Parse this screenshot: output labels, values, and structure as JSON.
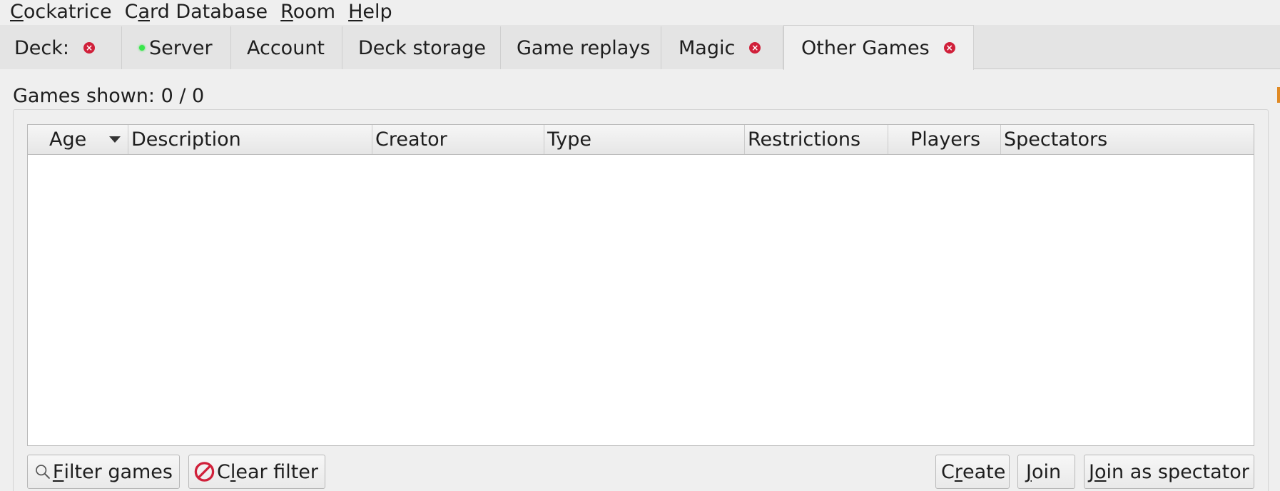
{
  "menubar": {
    "items": [
      {
        "label_first": "C",
        "label_rest": "ockatrice"
      },
      {
        "label_first": "C",
        "label_u": "a",
        "label_rest": "rd Database"
      },
      {
        "label_first": "R",
        "label_rest": "oom"
      },
      {
        "label_first": "H",
        "label_rest": "elp"
      }
    ]
  },
  "tabs": [
    {
      "label": "Deck:",
      "closable": true
    },
    {
      "label": "Server",
      "status": "connected"
    },
    {
      "label": "Account"
    },
    {
      "label": "Deck storage"
    },
    {
      "label": "Game replays"
    },
    {
      "label": "Magic",
      "closable": true
    },
    {
      "label": "Other Games",
      "closable": true,
      "active": true
    }
  ],
  "status": {
    "games_shown": "Games shown: 0 / 0"
  },
  "games_table": {
    "columns": [
      "Age",
      "Description",
      "Creator",
      "Type",
      "Restrictions",
      "Players",
      "Spectators"
    ],
    "sorted_column": "Age",
    "sort_direction": "descending",
    "rows": []
  },
  "buttons": {
    "filter_games": {
      "first": "F",
      "rest": "ilter games",
      "icon": "magnifier-icon"
    },
    "clear_filter": {
      "pre": "C",
      "u": "l",
      "rest": "ear filter",
      "icon": "no-entry-icon"
    },
    "create": {
      "pre": "C",
      "u": "r",
      "rest": "eate"
    },
    "join": {
      "u": "J",
      "rest": "oin"
    },
    "join_as_spectator": {
      "pre": "J",
      "u": "o",
      "rest": "in as spectator"
    }
  },
  "colors": {
    "close_badge": "#d0203a",
    "status_connected": "#39e64b",
    "no_entry": "#d0203a"
  }
}
